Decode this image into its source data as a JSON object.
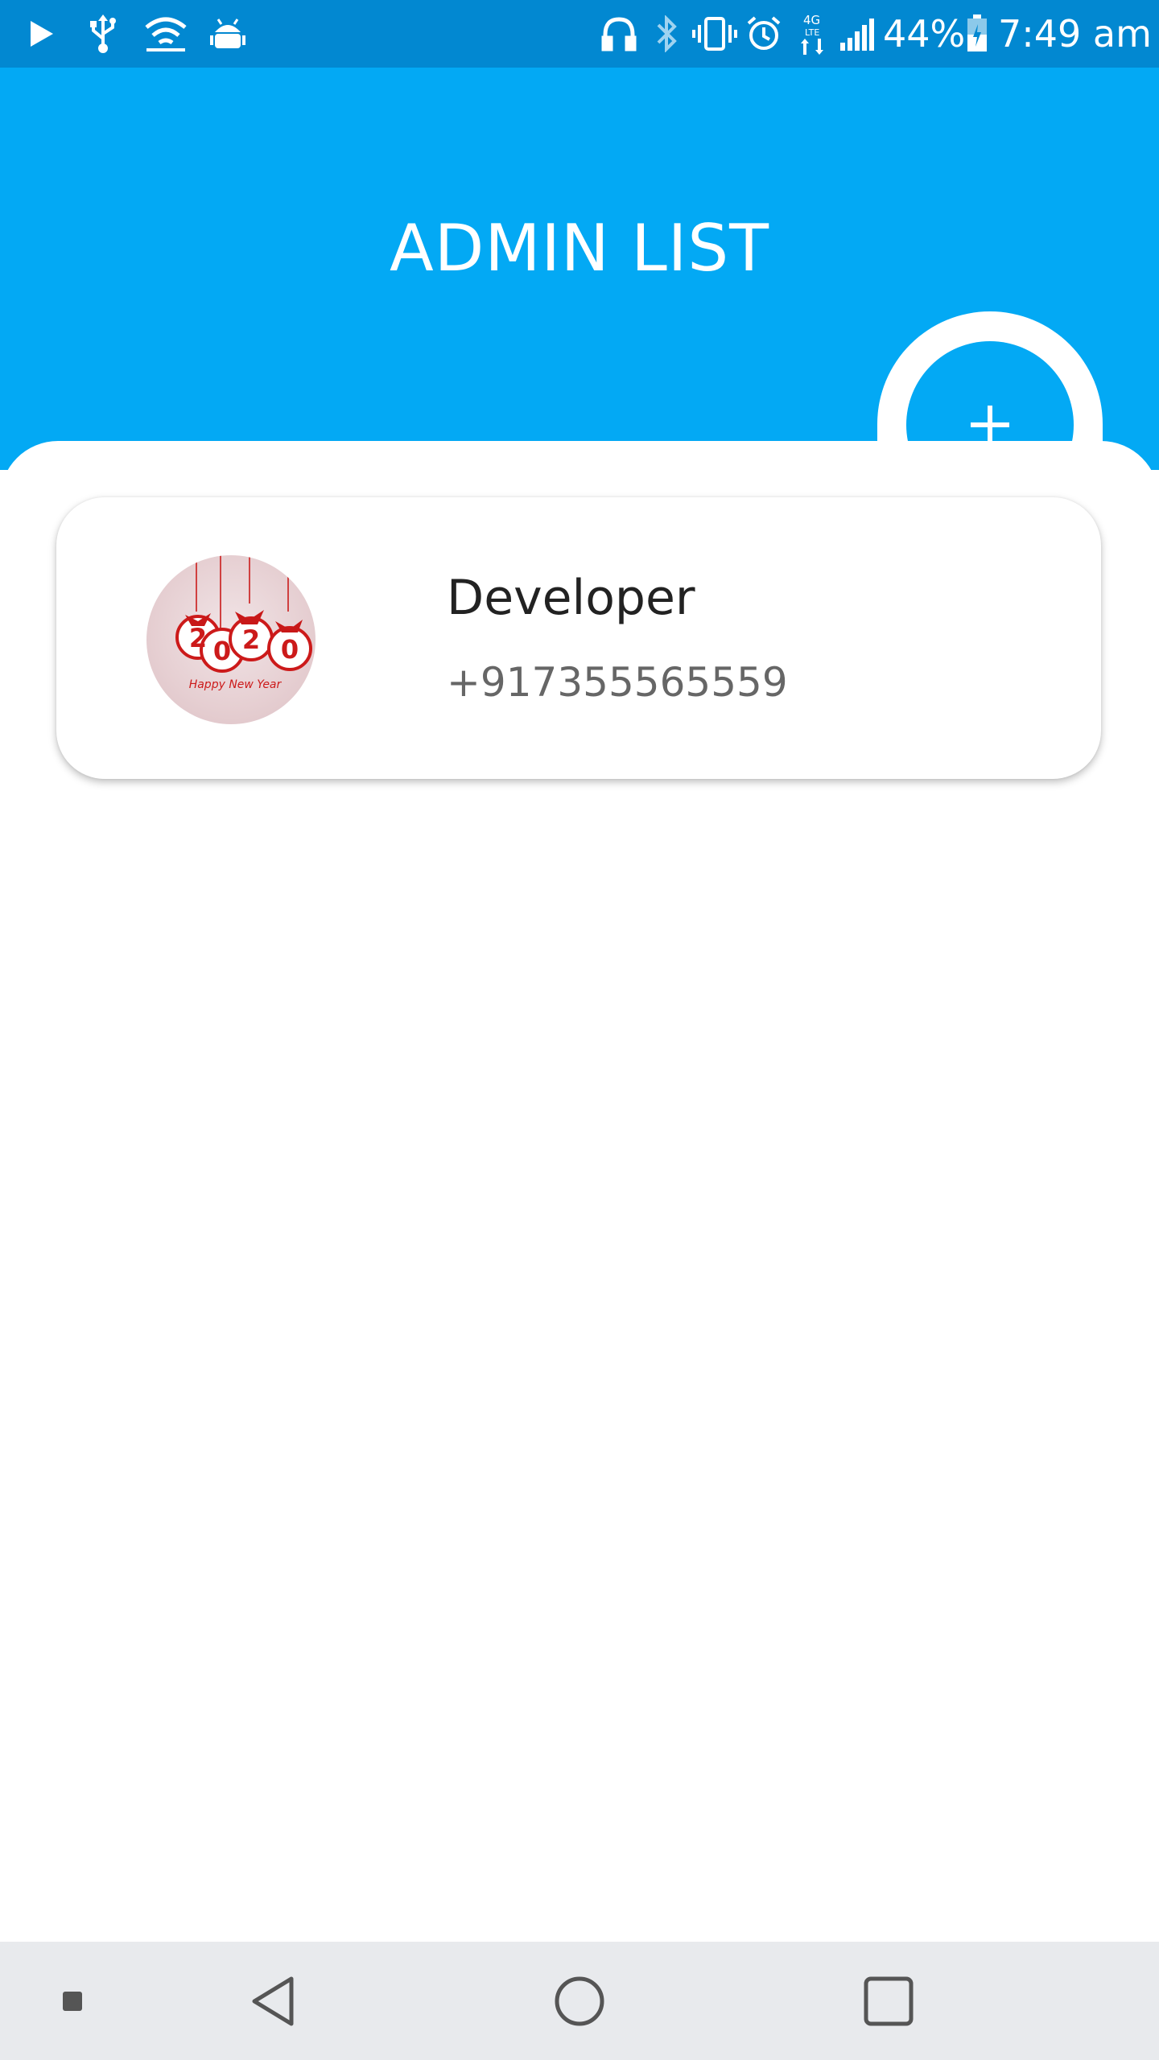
{
  "status_bar": {
    "battery_percent": "44%",
    "time": "7:49 am",
    "network_type": "4G LTE",
    "icons": [
      "play-icon",
      "usb-icon",
      "wifi-hotspot-icon",
      "android-debug-icon",
      "headphones-icon",
      "bluetooth-icon",
      "vibrate-icon",
      "alarm-icon",
      "data-arrows-icon",
      "signal-icon",
      "battery-icon"
    ]
  },
  "header": {
    "title": "ADMIN LIST",
    "add_button_label": "+"
  },
  "admins": [
    {
      "name": "Developer",
      "phone": "+917355565559",
      "avatar": {
        "digits": [
          "2",
          "0",
          "2",
          "0"
        ],
        "caption": "Happy New Year"
      }
    }
  ],
  "nav_bar": {
    "buttons": [
      "dot-icon",
      "back-icon",
      "home-icon",
      "recents-icon"
    ]
  },
  "colors": {
    "status_bar": "#0288d1",
    "header": "#03a9f4",
    "accent": "#03a9f4",
    "nav_bar": "#e8eaed"
  }
}
